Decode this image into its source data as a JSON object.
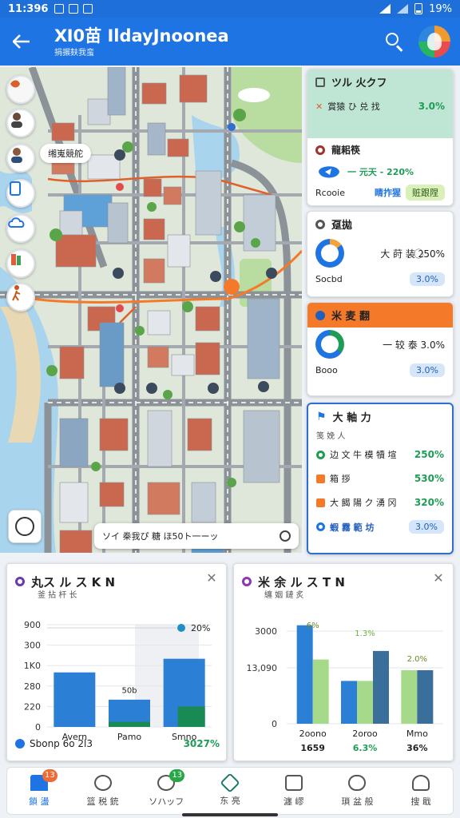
{
  "status": {
    "time": "11:396",
    "battery": "19%"
  },
  "header": {
    "title": "Ⅺ0苗 IldayJnoonea",
    "subtitle": "捐搌麸我蛮"
  },
  "map": {
    "label": "缃嵬競舵",
    "search_placeholder": "ソイ 桊我ぴ 糖 ほ50ト一ーッ"
  },
  "cards": {
    "card1": {
      "title": "ツル 火クフ",
      "row_label": "賞猿 ひ 兑 找",
      "row_value": "3.0%",
      "item_title": "龍耜筷",
      "stat": "一 元天 - 220%",
      "foot_left": "Rcooie",
      "foot_mid": "睛拃猩",
      "foot_pill": "赃跟陧"
    },
    "card2": {
      "title": "趸拋",
      "stat": "大 莳 装 2⃝50%",
      "foot_left": "Socbd",
      "foot_pill": "3.0%"
    },
    "card3": {
      "title": "米 麦 翻",
      "stat": "一 较 泰 3.0%",
      "foot_left": "Booo",
      "foot_pill": "3.0%"
    },
    "card4": {
      "title": "大 軸 力",
      "subtitle": "笺 娩 人",
      "rows": [
        {
          "label": "边 文 牛 模 犢 塇",
          "value": "250%"
        },
        {
          "label": "箱 拶",
          "value": "530%"
        },
        {
          "label": "大 餲 陽 ク 湧 冈",
          "value": "320%"
        }
      ],
      "foot_label": "蝦 霧 範 坊",
      "foot_pill": "3.0%"
    }
  },
  "chart_left": {
    "title": "丸ス ル ス K N",
    "subtitle": "釜 拈 杆 长",
    "legend_label": "Sbonp 6o 2l3",
    "legend_value": "3027%"
  },
  "chart_right": {
    "title": "米 余 ル ス T N",
    "subtitle": "纏 姻 鏈 炙"
  },
  "chart_data": [
    {
      "type": "bar",
      "title": "丸ス ル ス K N",
      "categories": [
        "Avern",
        "Pamo",
        "Smno"
      ],
      "ytick_labels": [
        "900",
        "300",
        "1K0",
        "280",
        "220",
        "0"
      ],
      "series": [
        {
          "values": [
            3.2,
            1.6,
            4.0
          ],
          "color": "#2b7fd4"
        },
        {
          "values": [
            0,
            0.3,
            1.2
          ],
          "color": "#1a8a55"
        }
      ],
      "data_labels": [
        "50b",
        "20%"
      ],
      "ylim": [
        0,
        6
      ]
    },
    {
      "type": "bar",
      "title": "米 余 ル ス T N",
      "categories": [
        "2oono",
        "2oroo",
        "Mmo"
      ],
      "ytick_labels": [
        "3000",
        "13,090",
        "0"
      ],
      "category_values": [
        "1659",
        "6.3%",
        "36%"
      ],
      "series": [
        {
          "values": [
            4.6,
            2.0,
            0
          ],
          "color": "#2b7fd4"
        },
        {
          "values": [
            3.0,
            2.0,
            2.5
          ],
          "color": "#a6d98a"
        },
        {
          "values": [
            0,
            3.4,
            2.5
          ],
          "color": "#3a6f9c"
        }
      ],
      "data_labels": [
        "6%",
        "1.3%",
        "2.0%"
      ],
      "ylim": [
        0,
        5
      ]
    }
  ],
  "nav": [
    {
      "label": "鎖 盪",
      "badge": "13"
    },
    {
      "label": "篮 税 銃",
      "badge": ""
    },
    {
      "label": "ソハッフ",
      "badge": "13"
    },
    {
      "label": "东 亮",
      "badge": ""
    },
    {
      "label": "瀍 嵺",
      "badge": ""
    },
    {
      "label": "瑣 盆 般",
      "badge": ""
    },
    {
      "label": "搜 戢",
      "badge": ""
    }
  ],
  "colors": {
    "primary": "#1f74e3",
    "accent_orange": "#f47a2a",
    "success": "#1f9d55"
  }
}
